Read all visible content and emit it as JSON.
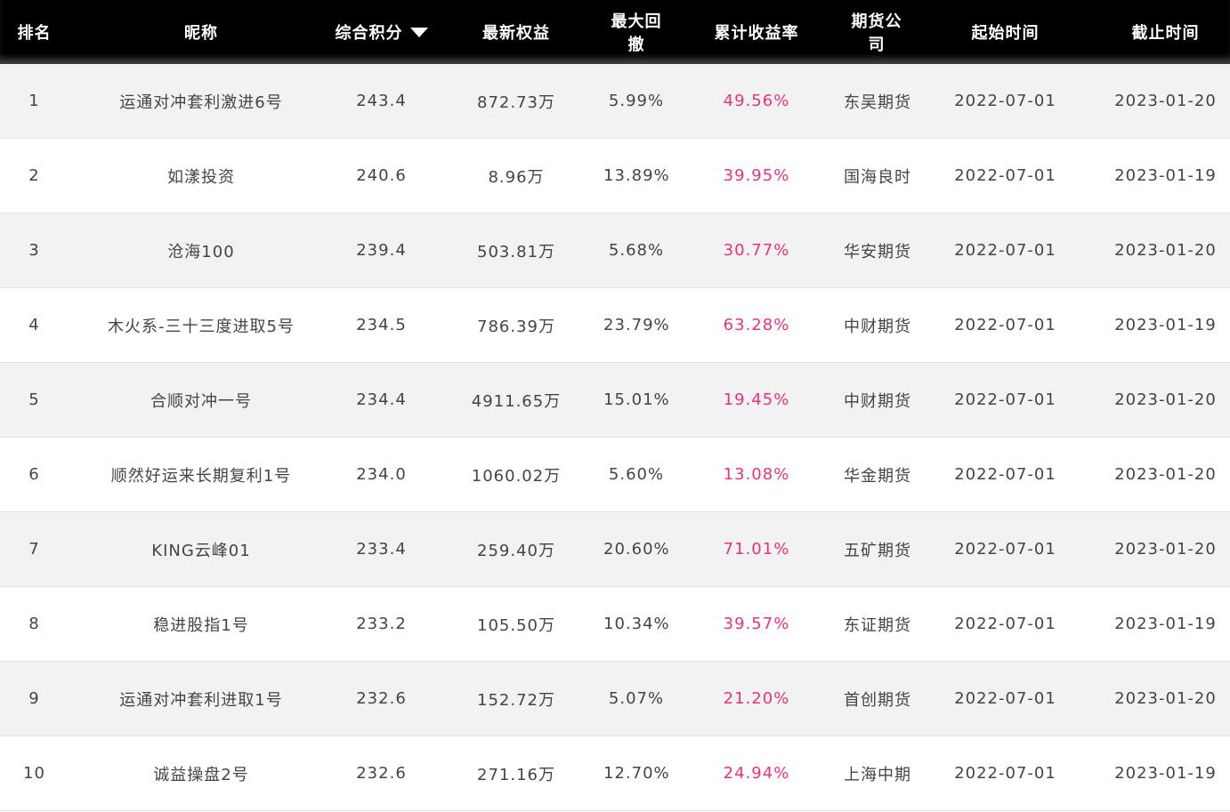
{
  "colors": {
    "header_bg": "#000000",
    "header_text": "#ffffff",
    "row_odd_bg": "#f2f2f2",
    "row_even_bg": "#ffffff",
    "text": "#444444",
    "rate_text": "#e8327f"
  },
  "table": {
    "headers": {
      "rank": "排名",
      "nickname": "昵称",
      "score": "综合积分",
      "equity": "最新权益",
      "drawdown": "最大回撤",
      "return_rate": "累计收益率",
      "company": "期货公司",
      "start": "起始时间",
      "end": "截止时间"
    },
    "sort_icon": "caret-down-icon",
    "rows": [
      {
        "rank": "1",
        "nickname": "运通对冲套利激进6号",
        "score": "243.4",
        "equity": "872.73万",
        "drawdown": "5.99%",
        "return_rate": "49.56%",
        "company": "东吴期货",
        "start": "2022-07-01",
        "end": "2023-01-20"
      },
      {
        "rank": "2",
        "nickname": "如漾投资",
        "score": "240.6",
        "equity": "8.96万",
        "drawdown": "13.89%",
        "return_rate": "39.95%",
        "company": "国海良时",
        "start": "2022-07-01",
        "end": "2023-01-19"
      },
      {
        "rank": "3",
        "nickname": "沧海100",
        "score": "239.4",
        "equity": "503.81万",
        "drawdown": "5.68%",
        "return_rate": "30.77%",
        "company": "华安期货",
        "start": "2022-07-01",
        "end": "2023-01-20"
      },
      {
        "rank": "4",
        "nickname": "木火系-三十三度进取5号",
        "score": "234.5",
        "equity": "786.39万",
        "drawdown": "23.79%",
        "return_rate": "63.28%",
        "company": "中财期货",
        "start": "2022-07-01",
        "end": "2023-01-19"
      },
      {
        "rank": "5",
        "nickname": "合顺对冲一号",
        "score": "234.4",
        "equity": "4911.65万",
        "drawdown": "15.01%",
        "return_rate": "19.45%",
        "company": "中财期货",
        "start": "2022-07-01",
        "end": "2023-01-20"
      },
      {
        "rank": "6",
        "nickname": "顺然好运来长期复利1号",
        "score": "234.0",
        "equity": "1060.02万",
        "drawdown": "5.60%",
        "return_rate": "13.08%",
        "company": "华金期货",
        "start": "2022-07-01",
        "end": "2023-01-20"
      },
      {
        "rank": "7",
        "nickname": "KING云峰01",
        "score": "233.4",
        "equity": "259.40万",
        "drawdown": "20.60%",
        "return_rate": "71.01%",
        "company": "五矿期货",
        "start": "2022-07-01",
        "end": "2023-01-20"
      },
      {
        "rank": "8",
        "nickname": "稳进股指1号",
        "score": "233.2",
        "equity": "105.50万",
        "drawdown": "10.34%",
        "return_rate": "39.57%",
        "company": "东证期货",
        "start": "2022-07-01",
        "end": "2023-01-19"
      },
      {
        "rank": "9",
        "nickname": "运通对冲套利进取1号",
        "score": "232.6",
        "equity": "152.72万",
        "drawdown": "5.07%",
        "return_rate": "21.20%",
        "company": "首创期货",
        "start": "2022-07-01",
        "end": "2023-01-20"
      },
      {
        "rank": "10",
        "nickname": "诚益操盘2号",
        "score": "232.6",
        "equity": "271.16万",
        "drawdown": "12.70%",
        "return_rate": "24.94%",
        "company": "上海中期",
        "start": "2022-07-01",
        "end": "2023-01-19"
      }
    ]
  }
}
